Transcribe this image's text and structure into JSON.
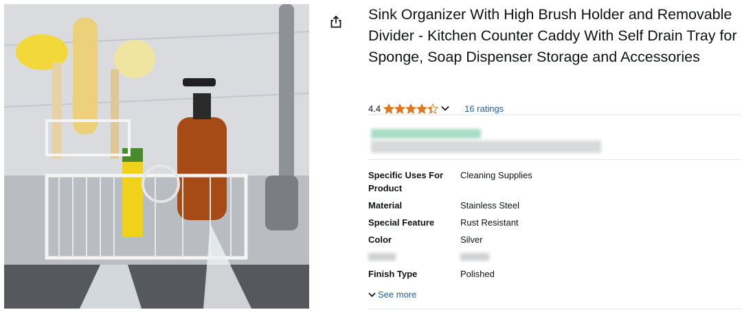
{
  "product": {
    "title": "Sink Organizer With High Brush Holder and Removable Divider - Kitchen Counter Caddy With Self Drain Tray for Sponge, Soap Dispenser Storage and Accessories",
    "rating_value": "4.4",
    "rating_fraction": 0.88,
    "ratings_count": "16 ratings",
    "star_color": "#de7921"
  },
  "specs": [
    {
      "key": "Specific Uses For Product",
      "value": "Cleaning Supplies"
    },
    {
      "key": "Material",
      "value": "Stainless Steel"
    },
    {
      "key": "Special Feature",
      "value": "Rust Resistant"
    },
    {
      "key": "Color",
      "value": "Silver"
    },
    {
      "key": "",
      "value": ""
    },
    {
      "key": "Finish Type",
      "value": "Polished"
    }
  ],
  "see_more": "See more",
  "icons": {
    "share": "share-icon",
    "chevron": "chevron-down-icon",
    "star": "star-icon"
  },
  "colors": {
    "link": "#2162a1",
    "star": "#de7921",
    "divider": "#e3e6e6"
  }
}
